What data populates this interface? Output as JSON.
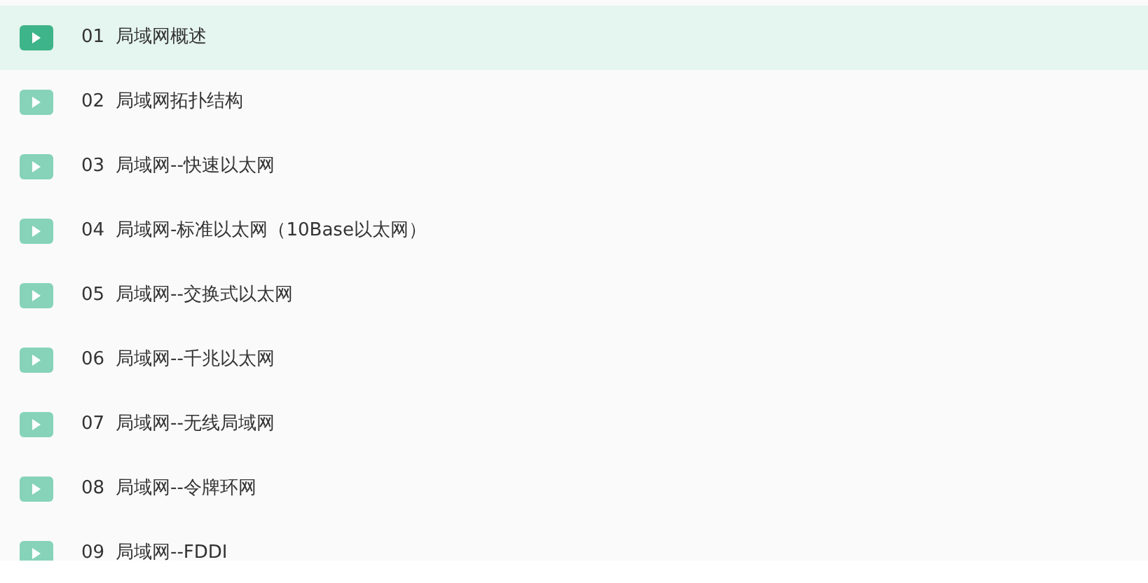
{
  "lessons": [
    {
      "number": "01",
      "title": "局域网概述",
      "selected": true
    },
    {
      "number": "02",
      "title": "局域网拓扑结构",
      "selected": false
    },
    {
      "number": "03",
      "title": "局域网--快速以太网",
      "selected": false
    },
    {
      "number": "04",
      "title": "局域网-标准以太网（10Base以太网）",
      "selected": false
    },
    {
      "number": "05",
      "title": "局域网--交换式以太网",
      "selected": false
    },
    {
      "number": "06",
      "title": "局域网--千兆以太网",
      "selected": false
    },
    {
      "number": "07",
      "title": "局域网--无线局域网",
      "selected": false
    },
    {
      "number": "08",
      "title": "局域网--令牌环网",
      "selected": false
    },
    {
      "number": "09",
      "title": "局域网--FDDI",
      "selected": false
    }
  ]
}
